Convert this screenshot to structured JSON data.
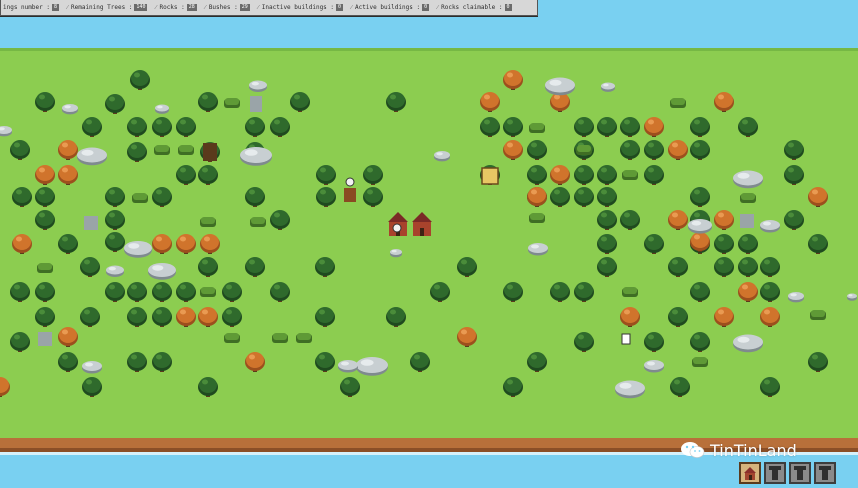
{
  "stats": [
    {
      "label": "ings number :",
      "value": "8"
    },
    {
      "label": "Remaining Trees :",
      "value": "140"
    },
    {
      "label": "Rocks :",
      "value": "28"
    },
    {
      "label": "Bushes :",
      "value": "29"
    },
    {
      "label": "Inactive buildings :",
      "value": "0"
    },
    {
      "label": "Active buildings :",
      "value": "0"
    },
    {
      "label": "Rocks claimable :",
      "value": "0"
    }
  ],
  "watermark": "TinTinLand",
  "toolbar": {
    "slots": [
      {
        "icon": "house-icon",
        "active": true
      },
      {
        "icon": "tower-icon",
        "active": false
      },
      {
        "icon": "tower-icon",
        "active": false
      },
      {
        "icon": "tower-icon",
        "active": false
      }
    ]
  },
  "colors": {
    "water": "#79d0f1",
    "grass": "#8ccd50",
    "dirt": "#b8703a",
    "tree_green": "#2f6a2c",
    "tree_orange": "#d0742c",
    "rock": "#c8cfd2",
    "bush": "#5f9a36"
  }
}
